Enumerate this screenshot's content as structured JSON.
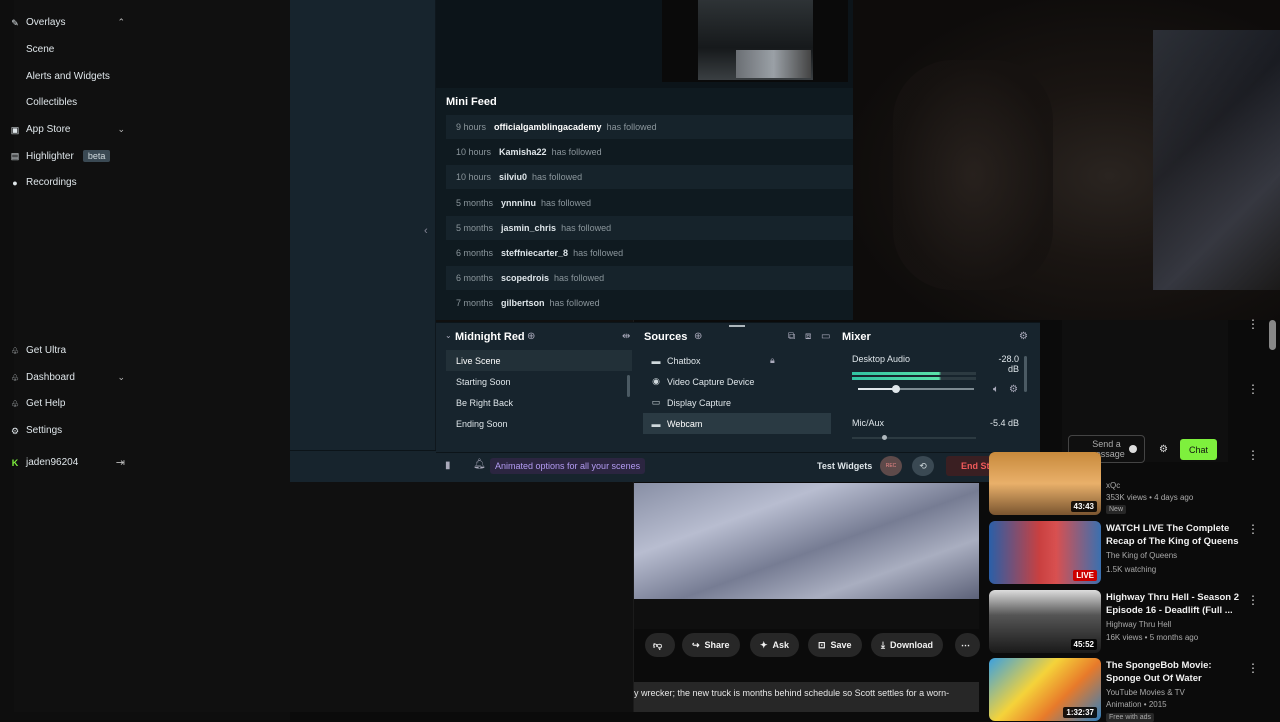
{
  "streamlabs": {
    "nav": {
      "overlays": "Overlays",
      "scene": "Scene",
      "alerts_widgets": "Alerts and Widgets",
      "collectibles": "Collectibles",
      "app_store": "App Store",
      "highlighter": "Highlighter",
      "highlighter_badge": "beta",
      "recordings": "Recordings",
      "get_ultra": "Get Ultra",
      "dashboard": "Dashboard",
      "get_help": "Get Help",
      "settings": "Settings",
      "username": "jaden96204"
    },
    "mini_feed": {
      "title": "Mini Feed",
      "events": [
        {
          "time": "9 hours",
          "user": "officialgamblingacademy",
          "action": "has followed"
        },
        {
          "time": "10 hours",
          "user": "Kamisha22",
          "action": "has followed"
        },
        {
          "time": "10 hours",
          "user": "silviu0",
          "action": "has followed"
        },
        {
          "time": "5 months",
          "user": "ynnninu",
          "action": "has followed"
        },
        {
          "time": "5 months",
          "user": "jasmin_chris",
          "action": "has followed"
        },
        {
          "time": "6 months",
          "user": "steffniecarter_8",
          "action": "has followed"
        },
        {
          "time": "6 months",
          "user": "scopedrois",
          "action": "has followed"
        },
        {
          "time": "7 months",
          "user": "gilbertson",
          "action": "has followed"
        }
      ]
    },
    "scenes": {
      "title": "Midnight Red",
      "items": [
        "Live Scene",
        "Starting Soon",
        "Be Right Back",
        "Ending Soon"
      ]
    },
    "sources": {
      "title": "Sources",
      "items": [
        {
          "label": "Chatbox",
          "icon": "chat-icon"
        },
        {
          "label": "Video Capture Device",
          "icon": "camera-icon"
        },
        {
          "label": "Display Capture",
          "icon": "monitor-icon"
        },
        {
          "label": "Webcam",
          "icon": "folder-icon"
        }
      ]
    },
    "mixer": {
      "title": "Mixer",
      "channels": [
        {
          "name": "Desktop Audio",
          "db": "-28.0 dB"
        },
        {
          "name": "Mic/Aux",
          "db": "-5.4 dB"
        }
      ]
    },
    "status": {
      "animated_options": "Animated options for all your scenes",
      "test_widgets": "Test Widgets",
      "end_stream": "End Stream",
      "rec_label": "REC"
    }
  },
  "chat": {
    "placeholder": "Send a message",
    "button": "Chat"
  },
  "youtube": {
    "actions": {
      "share": "Share",
      "ask": "Ask",
      "save": "Save",
      "download": "Download"
    },
    "description": "y wrecker; the new truck is months behind schedule so Scott settles for a worn-",
    "recommendations": [
      {
        "title": "",
        "channel": "xQc",
        "meta": "353K views • 4 days ago",
        "badge": "New",
        "duration": "43:43"
      },
      {
        "title": "WATCH LIVE The Complete Recap of The King of Queens",
        "channel": "The King of Queens",
        "meta": "1.5K watching",
        "duration": "LIVE"
      },
      {
        "title": "Highway Thru Hell - Season 2 Episode 16 - Deadlift (Full ...",
        "channel": "Highway Thru Hell",
        "meta": "16K views • 5 months ago",
        "duration": "45:52"
      },
      {
        "title": "The SpongeBob Movie: Sponge Out Of Water",
        "channel": "YouTube Movies & TV",
        "meta": "Animation • 2015",
        "badge": "Free with ads",
        "duration": "1:32:37"
      }
    ]
  },
  "colors": {
    "accent_green": "#7ef03d",
    "sl_panel": "#17242d",
    "end_stream_red": "#f05a5a",
    "meter_green": "#31c3a2",
    "purple_pill": "#b39bf2"
  }
}
